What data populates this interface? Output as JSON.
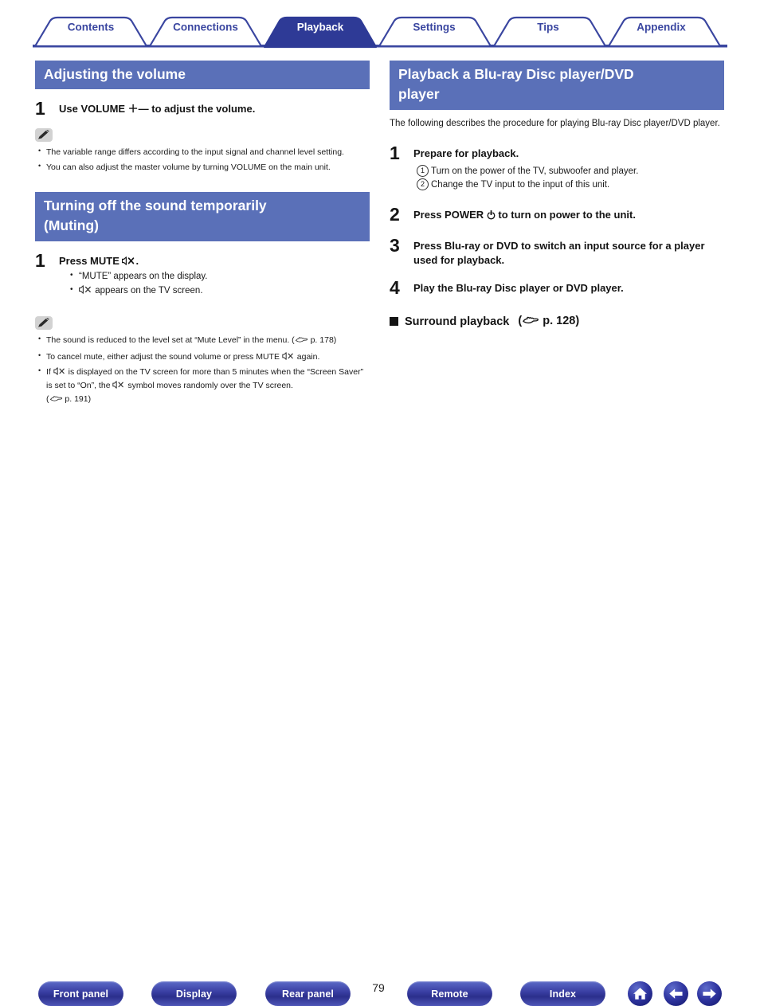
{
  "tabs": [
    {
      "label": "Contents",
      "active": false,
      "name": "tab-contents"
    },
    {
      "label": "Connections",
      "active": false,
      "name": "tab-connections"
    },
    {
      "label": "Playback",
      "active": true,
      "name": "tab-playback"
    },
    {
      "label": "Settings",
      "active": false,
      "name": "tab-settings"
    },
    {
      "label": "Tips",
      "active": false,
      "name": "tab-tips"
    },
    {
      "label": "Appendix",
      "active": false,
      "name": "tab-appendix"
    }
  ],
  "left": {
    "section1": {
      "heading": "Adjusting the volume",
      "step1_num": "1",
      "step1_title": "Use VOLUME ＋— to adjust the volume.",
      "notes": [
        "The variable range differs according to the input signal and channel level setting.",
        "You can also adjust the master volume by turning VOLUME on the main unit."
      ]
    },
    "section2": {
      "heading_line1": "Turning off the sound temporarily",
      "heading_line2": "(Muting)",
      "step1_num": "1",
      "step1_title_pre": "Press MUTE ",
      "step1_title_post": ".",
      "bullets_pre": [
        "“MUTE” appears on the display.",
        ""
      ],
      "bullet1": "“MUTE” appears on the display.",
      "bullet2_post": " appears on the TV screen.",
      "note1_pre": "The sound is reduced to the level set at “Mute Level” in the menu.  (",
      "note1_page": "p. 178",
      "note1_post": ")",
      "note2_pre": "To cancel mute, either adjust the sound volume or press MUTE ",
      "note2_post": " again.",
      "note3_a": "If ",
      "note3_b": " is displayed on the TV screen for more than 5 minutes when the “Screen Saver” is set to “On”, the ",
      "note3_c": " symbol moves randomly over the TV screen.",
      "note3_page": "p. 191"
    }
  },
  "right": {
    "heading_line1": "Playback a Blu-ray Disc player/DVD",
    "heading_line2": "player",
    "intro": "The following describes the procedure for playing Blu-ray Disc player/DVD player.",
    "steps": [
      {
        "num": "1",
        "title": "Prepare for playback.",
        "subs": [
          {
            "marker": "1",
            "text": "Turn on the power of the TV, subwoofer and player."
          },
          {
            "marker": "2",
            "text": "Change the TV input to the input of this unit."
          }
        ]
      },
      {
        "num": "2",
        "title_pre": "Press POWER ",
        "title_post": " to turn on power to the unit.",
        "icon": "power-icon"
      },
      {
        "num": "3",
        "title": "Press Blu-ray or DVD to switch an input source for a player used for playback."
      },
      {
        "num": "4",
        "title": "Play the Blu-ray Disc player or DVD player."
      }
    ],
    "subhead": "Surround playback",
    "subhead_page": "p. 128"
  },
  "footer": {
    "buttons": [
      {
        "label": "Front panel",
        "name": "front-panel-button"
      },
      {
        "label": "Display",
        "name": "display-button"
      },
      {
        "label": "Rear panel",
        "name": "rear-panel-button"
      },
      {
        "label": "Remote",
        "name": "remote-button"
      },
      {
        "label": "Index",
        "name": "index-button"
      }
    ],
    "page_number": "79",
    "icons": [
      {
        "name": "home-icon"
      },
      {
        "name": "arrow-left-icon"
      },
      {
        "name": "arrow-right-icon"
      }
    ]
  },
  "colors": {
    "heading_bar": "#5a70b8",
    "tab_active": "#2e3a96",
    "tab_outline": "#3a46a0",
    "pill": "#32379c"
  }
}
